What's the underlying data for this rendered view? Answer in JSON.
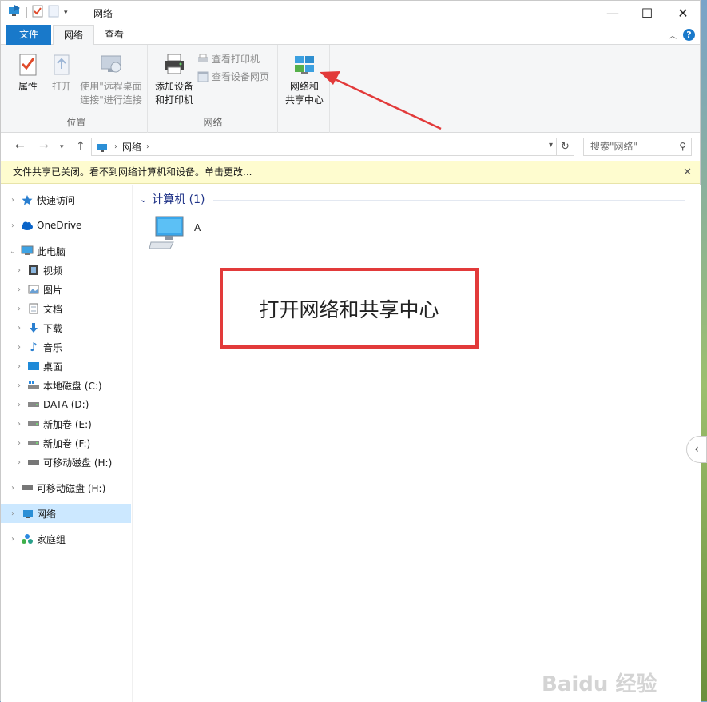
{
  "window": {
    "title": "网络",
    "minimize": "—",
    "maximize": "☐",
    "close": "✕"
  },
  "tabs": {
    "file": "文件",
    "network": "网络",
    "view": "查看"
  },
  "ribbon": {
    "location_group": {
      "label": "位置",
      "properties": "属性",
      "open": "打开",
      "remote_line1": "使用\"远程桌面",
      "remote_line2": "连接\"进行连接"
    },
    "network_group": {
      "label": "网络",
      "add_line1": "添加设备",
      "add_line2": "和打印机",
      "view_printers": "查看打印机",
      "view_device_web": "查看设备网页"
    },
    "sharing": {
      "line1": "网络和",
      "line2": "共享中心"
    }
  },
  "address": {
    "crumb": "网络",
    "search_placeholder": "搜索\"网络\""
  },
  "infobar": {
    "text": "文件共享已关闭。看不到网络计算机和设备。单击更改..."
  },
  "nav": {
    "quick_access": "快速访问",
    "onedrive": "OneDrive",
    "this_pc": "此电脑",
    "videos": "视频",
    "pictures": "图片",
    "documents": "文档",
    "downloads": "下载",
    "music": "音乐",
    "desktop": "桌面",
    "local_c": "本地磁盘 (C:)",
    "data_d": "DATA (D:)",
    "vol_e": "新加卷 (E:)",
    "vol_f": "新加卷 (F:)",
    "removable_h_sub": "可移动磁盘 (H:)",
    "removable_h": "可移动磁盘 (H:)",
    "network": "网络",
    "homegroup": "家庭组"
  },
  "content": {
    "group_header": "计算机 (1)",
    "computer_name": "A"
  },
  "annotation": {
    "callout": "打开网络和共享中心"
  },
  "watermark": "Baidu 经验",
  "colors": {
    "accent": "#1979ca",
    "callout_border": "#e23a3a",
    "selection": "#cce8ff",
    "infobar": "#fefccf"
  }
}
